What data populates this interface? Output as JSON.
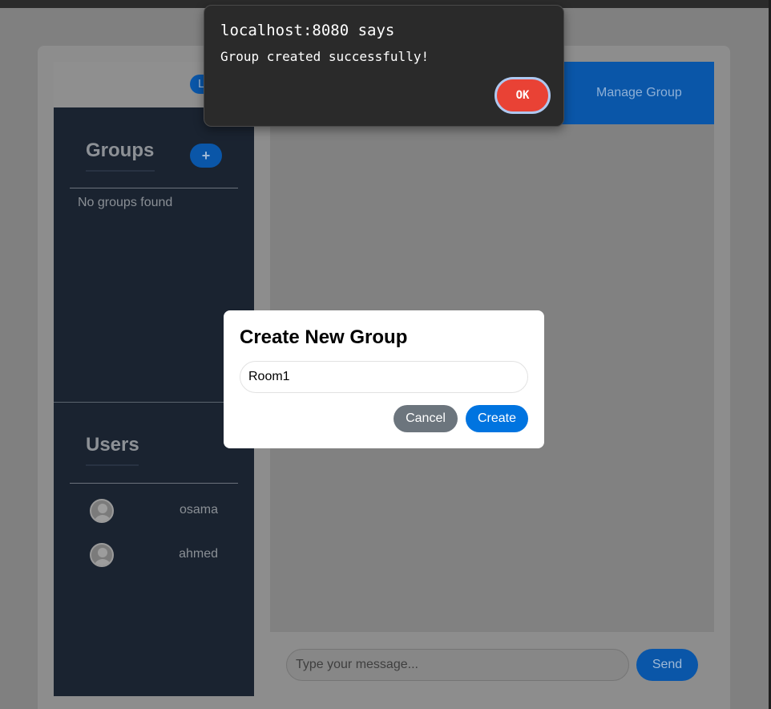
{
  "alert": {
    "title": "localhost:8080 says",
    "message": "Group created successfully!",
    "ok_label": "OK"
  },
  "header": {
    "logout_label": "L",
    "manage_group_label": "Manage Group"
  },
  "sidebar": {
    "groups_title": "Groups",
    "add_group_label": "+",
    "no_groups_text": "No groups found",
    "users_title": "Users",
    "users": [
      {
        "name": "osama",
        "icon": "user-avatar-icon"
      },
      {
        "name": "ahmed",
        "icon": "user-avatar-icon"
      }
    ]
  },
  "modal": {
    "title": "Create New Group",
    "group_name_value": "Room1",
    "cancel_label": "Cancel",
    "create_label": "Create"
  },
  "footer": {
    "message_placeholder": "Type your message...",
    "send_label": "Send"
  },
  "colors": {
    "primary": "#0074e0",
    "sidebar_bg": "#1a2330",
    "cancel_bg": "#6c757d",
    "alert_ok": "#e94235"
  }
}
